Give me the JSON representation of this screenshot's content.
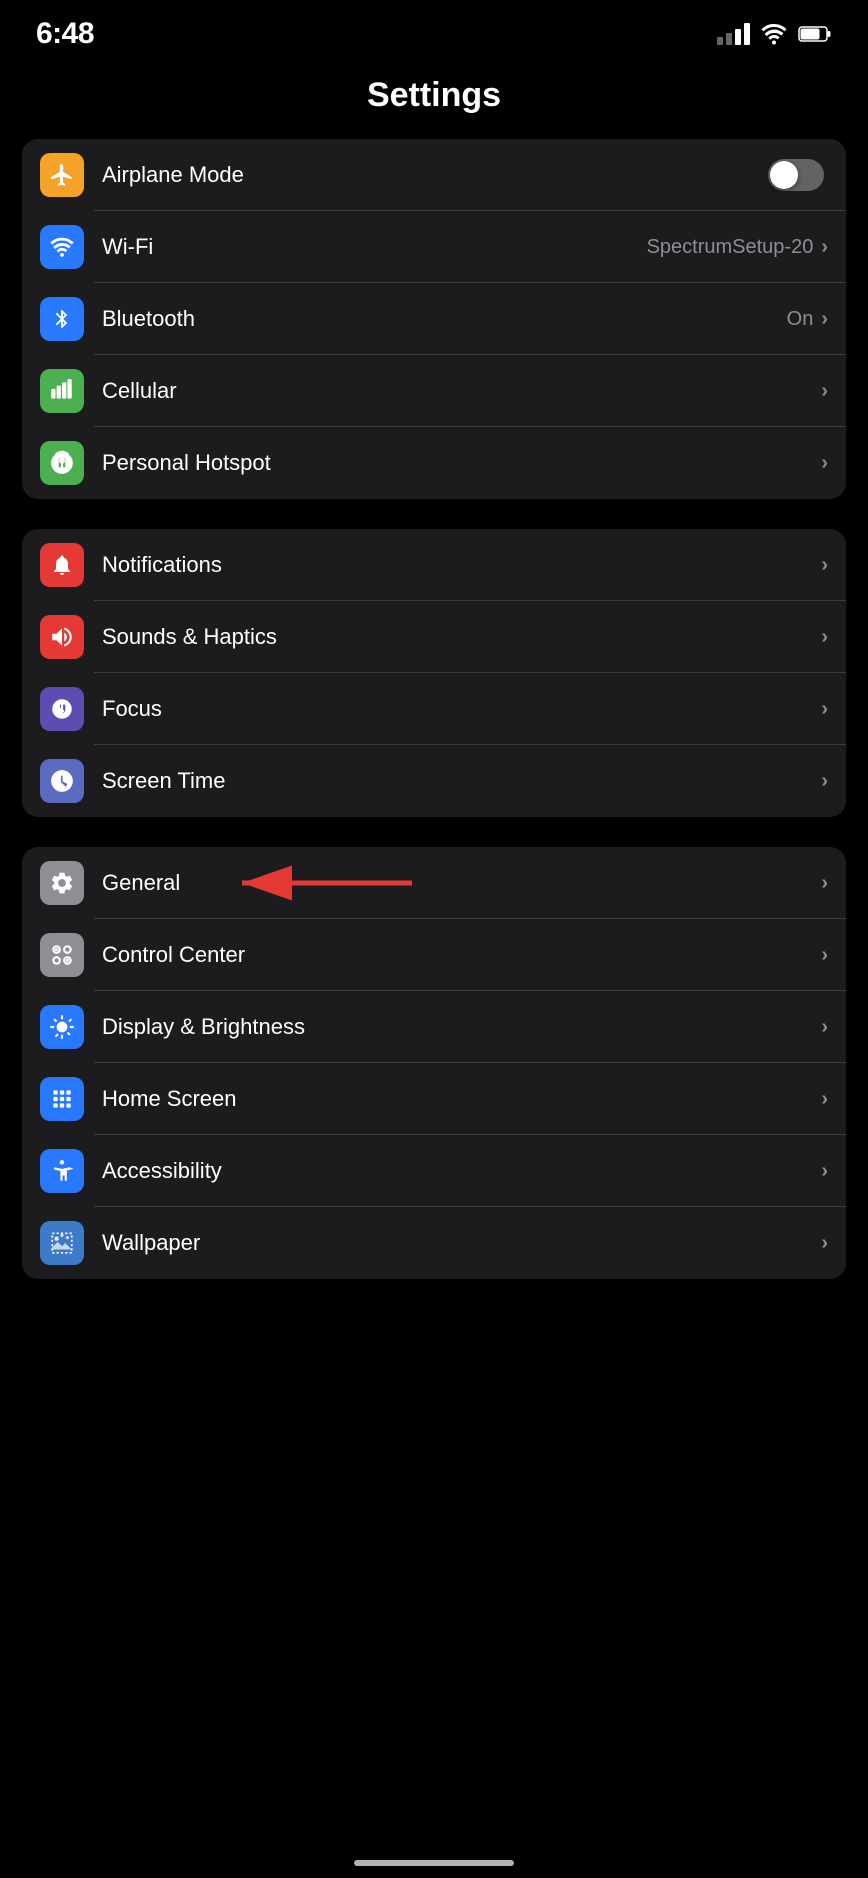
{
  "statusBar": {
    "time": "6:48",
    "signal": "2 bars",
    "wifi": true,
    "battery": "75%"
  },
  "pageTitle": "Settings",
  "groups": [
    {
      "id": "connectivity",
      "items": [
        {
          "id": "airplane-mode",
          "label": "Airplane Mode",
          "icon": "airplane",
          "iconColor": "#f4a228",
          "hasToggle": true,
          "toggleOn": false,
          "value": "",
          "hasChevron": false
        },
        {
          "id": "wifi",
          "label": "Wi-Fi",
          "icon": "wifi",
          "iconColor": "#2979ff",
          "hasToggle": false,
          "value": "SpectrumSetup-20",
          "hasChevron": true
        },
        {
          "id": "bluetooth",
          "label": "Bluetooth",
          "icon": "bluetooth",
          "iconColor": "#2979ff",
          "hasToggle": false,
          "value": "On",
          "hasChevron": true
        },
        {
          "id": "cellular",
          "label": "Cellular",
          "icon": "cellular",
          "iconColor": "#4caf50",
          "hasToggle": false,
          "value": "",
          "hasChevron": true
        },
        {
          "id": "personal-hotspot",
          "label": "Personal Hotspot",
          "icon": "hotspot",
          "iconColor": "#4caf50",
          "hasToggle": false,
          "value": "",
          "hasChevron": true
        }
      ]
    },
    {
      "id": "notifications-group",
      "items": [
        {
          "id": "notifications",
          "label": "Notifications",
          "icon": "notifications",
          "iconColor": "#e53935",
          "hasToggle": false,
          "value": "",
          "hasChevron": true
        },
        {
          "id": "sounds-haptics",
          "label": "Sounds & Haptics",
          "icon": "sounds",
          "iconColor": "#e53935",
          "hasToggle": false,
          "value": "",
          "hasChevron": true
        },
        {
          "id": "focus",
          "label": "Focus",
          "icon": "focus",
          "iconColor": "#5c4db1",
          "hasToggle": false,
          "value": "",
          "hasChevron": true
        },
        {
          "id": "screen-time",
          "label": "Screen Time",
          "icon": "screentime",
          "iconColor": "#5c6bc0",
          "hasToggle": false,
          "value": "",
          "hasChevron": true
        }
      ]
    },
    {
      "id": "system-group",
      "items": [
        {
          "id": "general",
          "label": "General",
          "icon": "general",
          "iconColor": "#8e8e93",
          "hasToggle": false,
          "value": "",
          "hasChevron": true,
          "hasArrow": true
        },
        {
          "id": "control-center",
          "label": "Control Center",
          "icon": "controlcenter",
          "iconColor": "#8e8e93",
          "hasToggle": false,
          "value": "",
          "hasChevron": true
        },
        {
          "id": "display-brightness",
          "label": "Display & Brightness",
          "icon": "display",
          "iconColor": "#2979ff",
          "hasToggle": false,
          "value": "",
          "hasChevron": true
        },
        {
          "id": "home-screen",
          "label": "Home Screen",
          "icon": "homescreen",
          "iconColor": "#2979ff",
          "hasToggle": false,
          "value": "",
          "hasChevron": true
        },
        {
          "id": "accessibility",
          "label": "Accessibility",
          "icon": "accessibility",
          "iconColor": "#2979ff",
          "hasToggle": false,
          "value": "",
          "hasChevron": true
        },
        {
          "id": "wallpaper",
          "label": "Wallpaper",
          "icon": "wallpaper",
          "iconColor": "#3d7ac8",
          "hasToggle": false,
          "value": "",
          "hasChevron": true
        }
      ]
    }
  ]
}
